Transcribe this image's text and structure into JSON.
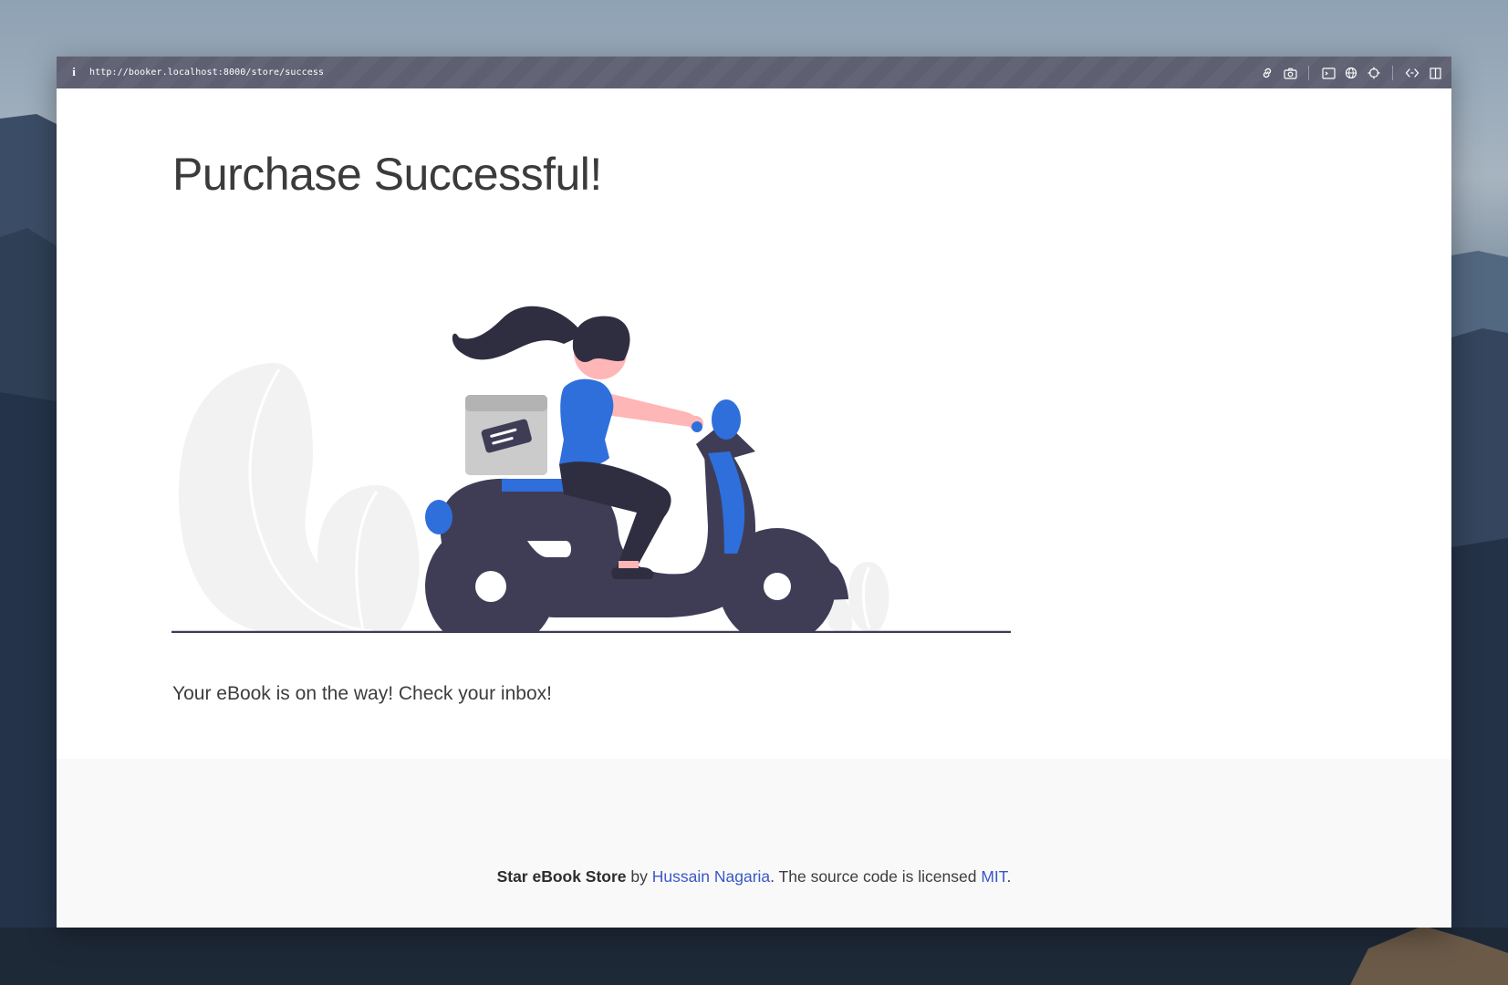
{
  "browser": {
    "url": "http://booker.localhost:8000/store/success",
    "info_icon": "info-icon",
    "toolbar_icons": [
      "link-icon",
      "camera-icon",
      "terminal-icon",
      "globe-icon",
      "crosshair-icon",
      "code-icon",
      "split-view-icon"
    ]
  },
  "page": {
    "title": "Purchase Successful!",
    "message": "Your eBook is on the way! Check your inbox!",
    "illustration": "woman-riding-scooter-delivery-illustration"
  },
  "footer": {
    "brand": "Star eBook Store",
    "by_text": " by ",
    "author_link": "Hussain Nagaria",
    "license_text": ". The source code is licensed ",
    "license_link": "MIT",
    "end_text": "."
  },
  "colors": {
    "accent_blue": "#2e6fdb",
    "scooter_dark": "#3f3d56",
    "link_blue": "#3a57c7",
    "skin": "#ffb6b6"
  }
}
